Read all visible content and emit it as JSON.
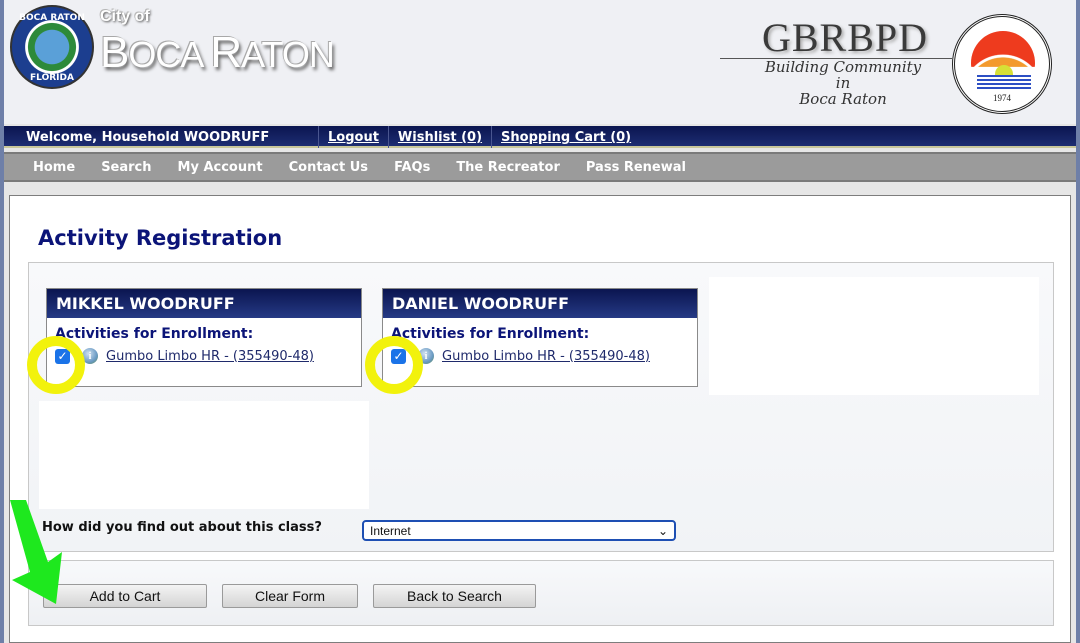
{
  "header": {
    "city_of": "City of",
    "city_name_first_cap": "B",
    "city_name_first_rest": "OCA ",
    "city_name_second_cap": "R",
    "city_name_second_rest": "ATON",
    "seal_top_text": "BOCA RATON",
    "seal_bottom_text": "FLORIDA",
    "district_abbrev": "GBRBPD",
    "district_tagline_line1": "Building Community",
    "district_tagline_line2": "in",
    "district_tagline_line3": "Boca Raton",
    "district_seal_year": "1974",
    "district_seal_name": "Greater Boca Raton Beach & Park District"
  },
  "welcome_bar": {
    "welcome_text": "Welcome, Household WOODRUFF",
    "links": [
      "Logout",
      "Wishlist (0)",
      "Shopping Cart (0)"
    ]
  },
  "nav": {
    "items": [
      "Home",
      "Search",
      "My Account",
      "Contact Us",
      "FAQs",
      "The Recreator",
      "Pass Renewal"
    ]
  },
  "main": {
    "page_title": "Activity Registration",
    "participants": [
      {
        "name": "MIKKEL WOODRUFF",
        "section_label": "Activities for Enrollment:",
        "activities": [
          {
            "label": "Gumbo Limbo HR - (355490-48)",
            "checked": true
          }
        ]
      },
      {
        "name": "DANIEL WOODRUFF",
        "section_label": "Activities for Enrollment:",
        "activities": [
          {
            "label": "Gumbo Limbo HR - (355490-48)",
            "checked": true
          }
        ]
      }
    ],
    "referral_question": "How did you find out about this class?",
    "referral_selected": "Internet",
    "buttons": {
      "add_to_cart": "Add to Cart",
      "clear_form": "Clear Form",
      "back_to_search": "Back to Search"
    }
  },
  "icons": {
    "checkbox_checked": "✓",
    "info": "i",
    "chevron_down": "⌄"
  },
  "annotations": {
    "highlight_color": "#f2f20c",
    "arrow_color": "#1ee81e"
  }
}
